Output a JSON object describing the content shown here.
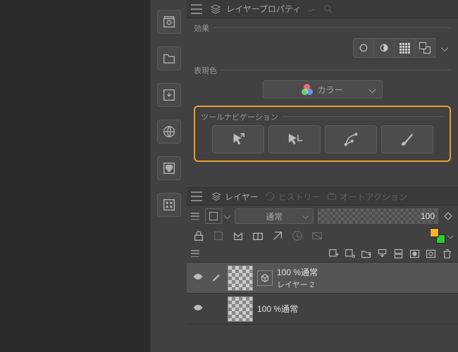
{
  "tabs": {
    "layer_property": "レイヤープロパティ"
  },
  "sections": {
    "effects": "効果",
    "rendering_color": "表現色",
    "tool_nav": "ツールナビゲーション"
  },
  "color_dropdown": {
    "label": "カラー"
  },
  "layer_panel": {
    "tabs": {
      "layer": "レイヤー",
      "history": "ヒストリー",
      "auto_action": "オートアクション"
    },
    "blend_mode": "通常",
    "opacity": "100"
  },
  "layers": [
    {
      "opacity_label": "100 %通常",
      "name": "レイヤー 2",
      "selected": true
    },
    {
      "opacity_label": "100 %通常",
      "name": "",
      "selected": false
    }
  ]
}
